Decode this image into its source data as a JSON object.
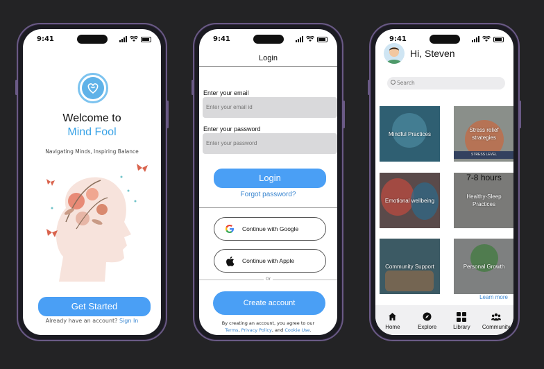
{
  "status": {
    "time": "9:41"
  },
  "screen1": {
    "welcome": "Welcome to",
    "app_name": "Mind Fool",
    "tagline": "Navigating Minds, Inspiring Balance",
    "get_started": "Get Started",
    "already_text": "Already have an account?",
    "sign_in": "Sign In"
  },
  "screen2": {
    "title": "Login",
    "email_label": "Enter your email",
    "email_placeholder": "Enter your email id",
    "password_label": "Enter your password",
    "password_placeholder": "Enter your password",
    "login_button": "Login",
    "forgot": "Forgot password?",
    "google": "Continue with Google",
    "apple": "Continue with Apple",
    "or": "Or",
    "create_account": "Create account",
    "terms_prefix": "By creating an account, you agree to our",
    "terms_link": "Terms",
    "privacy_link": "Privacy Policy",
    "and_text": ", and",
    "cookie_link": "Cookie Use"
  },
  "screen3": {
    "greeting": "Hi, Steven",
    "search_placeholder": "Search",
    "tiles": [
      {
        "label": "Mindful Practices",
        "color": "#2f5f72"
      },
      {
        "label": "Stress relief strategies",
        "color": "#8a8f8a"
      },
      {
        "label": "Emotional wellbeing",
        "color": "#5a4a4a"
      },
      {
        "label": "Healthy-Sleep Practices",
        "color": "#7a7a78"
      },
      {
        "label": "Community Support",
        "color": "#3c5a64"
      },
      {
        "label": "Personal Growth",
        "color": "#7e8080"
      }
    ],
    "tile_caption_sleep": "7-8 hours",
    "tile_caption_stress": "STRESS LEVEL",
    "learn_more": "Learn more",
    "tabs": [
      "Home",
      "Explore",
      "Library",
      "Community"
    ]
  },
  "colors": {
    "accent": "#4a9ff5",
    "link": "#3a86d0",
    "brand": "#3aa3e6"
  }
}
